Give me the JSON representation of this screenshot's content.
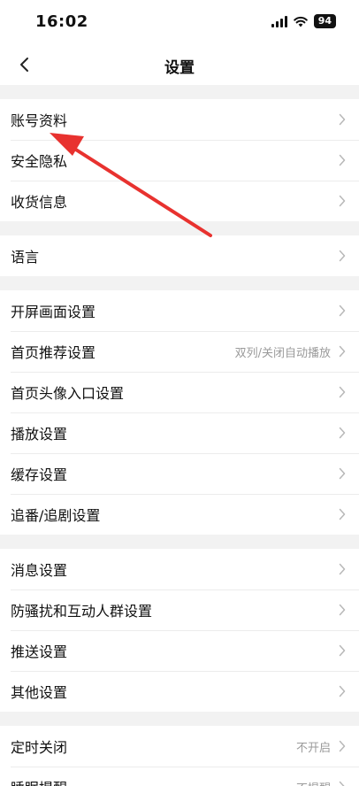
{
  "status": {
    "time": "16:02",
    "battery": "94"
  },
  "nav": {
    "title": "设置"
  },
  "groups": [
    {
      "items": [
        {
          "label": "账号资料"
        },
        {
          "label": "安全隐私"
        },
        {
          "label": "收货信息"
        }
      ]
    },
    {
      "items": [
        {
          "label": "语言"
        }
      ]
    },
    {
      "items": [
        {
          "label": "开屏画面设置"
        },
        {
          "label": "首页推荐设置",
          "value": "双列/关闭自动播放"
        },
        {
          "label": "首页头像入口设置"
        },
        {
          "label": "播放设置"
        },
        {
          "label": "缓存设置"
        },
        {
          "label": "追番/追剧设置"
        }
      ]
    },
    {
      "items": [
        {
          "label": "消息设置"
        },
        {
          "label": "防骚扰和互动人群设置"
        },
        {
          "label": "推送设置"
        },
        {
          "label": "其他设置"
        }
      ]
    },
    {
      "items": [
        {
          "label": "定时关闭",
          "value": "不开启"
        },
        {
          "label": "睡眠提醒",
          "value": "不提醒"
        }
      ]
    }
  ],
  "annotation": {
    "color": "#e8322f"
  }
}
